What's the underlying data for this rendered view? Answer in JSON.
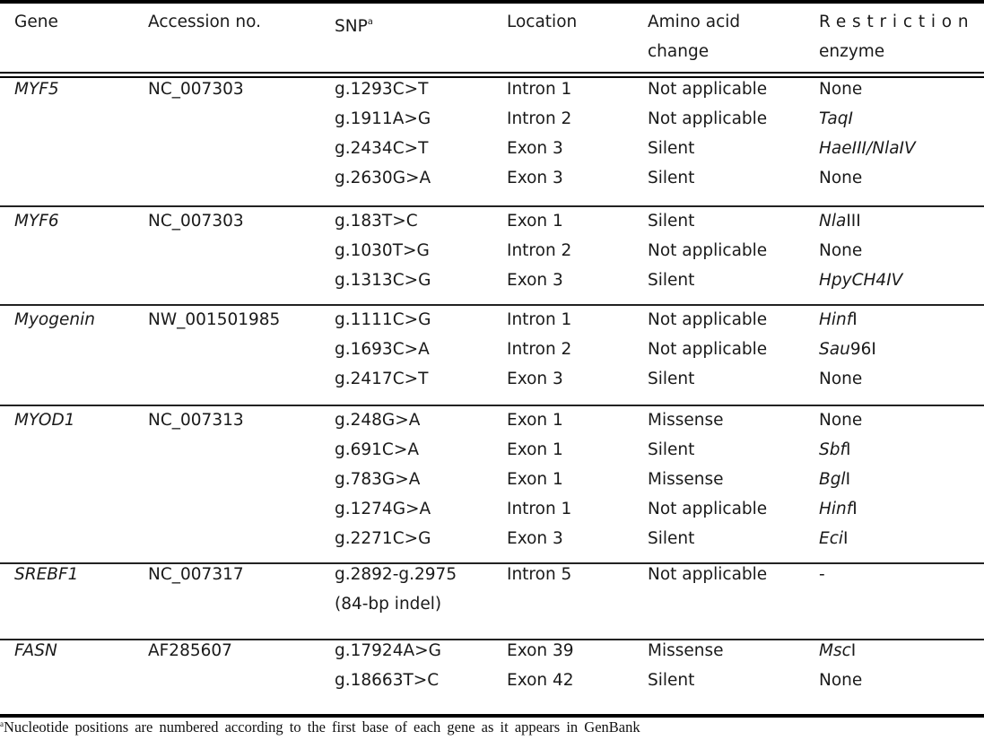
{
  "table": {
    "headers": [
      {
        "line1": "Gene",
        "line2": ""
      },
      {
        "line1": "Accession no.",
        "line2": ""
      },
      {
        "line1": "SNP",
        "sup": "a",
        "line2": ""
      },
      {
        "line1": "Location",
        "line2": ""
      },
      {
        "line1": "Amino acid",
        "line2": "change"
      },
      {
        "line1": "Restriction",
        "line2": "enzyme"
      }
    ],
    "groups": [
      {
        "gene": "MYF5",
        "accession": "NC_007303",
        "rows": [
          {
            "snp": "g.1293C>T",
            "location": "Intron 1",
            "aa_change": "Not applicable",
            "enzyme": "None",
            "enzyme_italic": false
          },
          {
            "snp": "g.1911A>G",
            "location": "Intron 2",
            "aa_change": "Not applicable",
            "enzyme": "TaqI",
            "enzyme_italic": true
          },
          {
            "snp": "g.2434C>T",
            "location": "Exon 3",
            "aa_change": "Silent",
            "enzyme": "HaeIII/NlaIV",
            "enzyme_italic": true
          },
          {
            "snp": "g.2630G>A",
            "location": "Exon 3",
            "aa_change": "Silent",
            "enzyme": "None",
            "enzyme_italic": false
          }
        ]
      },
      {
        "gene": "MYF6",
        "accession": "NC_007303",
        "rows": [
          {
            "snp": "g.183T>C",
            "location": "Exon 1",
            "aa_change": "Silent",
            "enzyme_it": "Nla",
            "enzyme_rest": "III"
          },
          {
            "snp": "g.1030T>G",
            "location": "Intron 2",
            "aa_change": "Not applicable",
            "enzyme": "None",
            "enzyme_italic": false
          },
          {
            "snp": "g.1313C>G",
            "location": "Exon 3",
            "aa_change": "Silent",
            "enzyme": "HpyCH4IV",
            "enzyme_italic": true
          }
        ]
      },
      {
        "gene": "Myogenin",
        "accession": "NW_001501985",
        "rows": [
          {
            "snp": "g.1111C>G",
            "location": "Intron 1",
            "aa_change": "Not applicable",
            "enzyme_it": "Hinf",
            "enzyme_rest": "I"
          },
          {
            "snp": "g.1693C>A",
            "location": "Intron 2",
            "aa_change": "Not applicable",
            "enzyme_it": "Sau",
            "enzyme_rest": "96I"
          },
          {
            "snp": "g.2417C>T",
            "location": "Exon 3",
            "aa_change": "Silent",
            "enzyme": "None",
            "enzyme_italic": false
          }
        ]
      },
      {
        "gene": "MYOD1",
        "accession": "NC_007313",
        "rows": [
          {
            "snp": "g.248G>A",
            "location": "Exon 1",
            "aa_change": "Missense",
            "enzyme": "None",
            "enzyme_italic": false
          },
          {
            "snp": "g.691C>A",
            "location": "Exon 1",
            "aa_change": "Silent",
            "enzyme_it": "Sbf",
            "enzyme_rest": "I"
          },
          {
            "snp": "g.783G>A",
            "location": "Exon 1",
            "aa_change": "Missense",
            "enzyme_it": "Bgl",
            "enzyme_rest": "I"
          },
          {
            "snp": "g.1274G>A",
            "location": "Intron 1",
            "aa_change": "Not applicable",
            "enzyme_it": "Hinf",
            "enzyme_rest": "I"
          },
          {
            "snp": "g.2271C>G",
            "location": "Exon 3",
            "aa_change": "Silent",
            "enzyme_it": "Eci",
            "enzyme_rest": "I"
          }
        ]
      },
      {
        "gene": "SREBF1",
        "accession": "NC_007317",
        "rows": [
          {
            "snp": "g.2892-g.2975",
            "location": "Intron 5",
            "aa_change": "Not applicable",
            "enzyme": "-",
            "enzyme_italic": false
          },
          {
            "snp": "(84-bp indel)",
            "location": "",
            "aa_change": "",
            "enzyme": "",
            "enzyme_italic": false
          }
        ]
      },
      {
        "gene": "FASN",
        "accession": "AF285607",
        "rows": [
          {
            "snp": "g.17924A>G",
            "location": "Exon 39",
            "aa_change": "Missense",
            "enzyme_it": "Msc",
            "enzyme_rest": "I"
          },
          {
            "snp": "g.18663T>C",
            "location": "Exon 42",
            "aa_change": "Silent",
            "enzyme": "None",
            "enzyme_italic": false
          }
        ]
      }
    ]
  },
  "footnote": {
    "marker": "a",
    "text": "Nucleotide positions are numbered according to the first base of each gene as it appears in GenBank"
  }
}
